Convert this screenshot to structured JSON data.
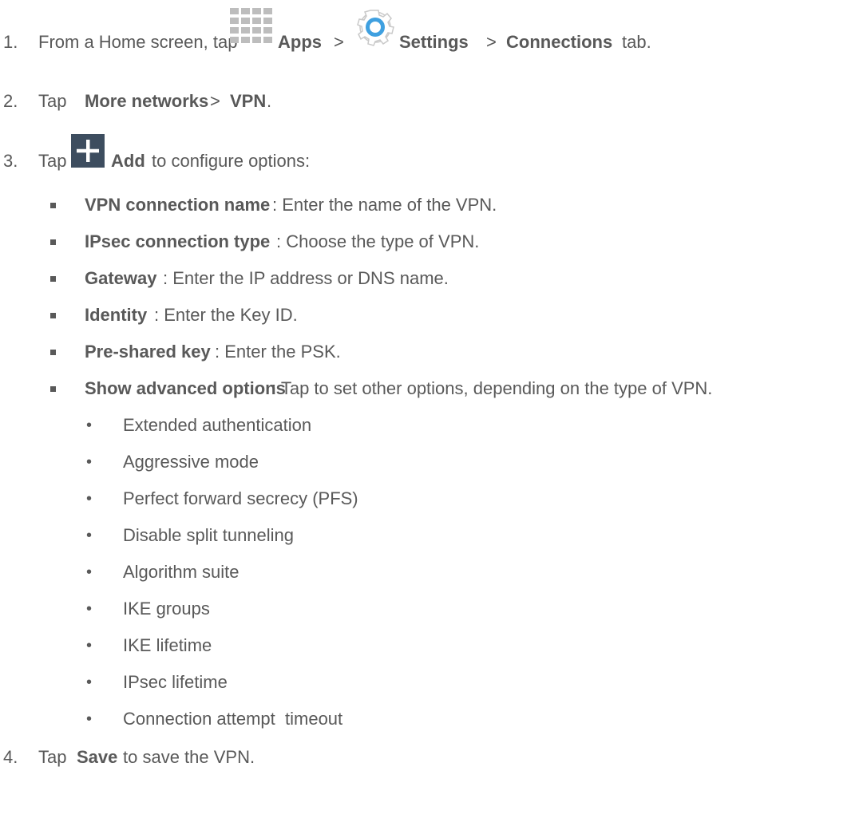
{
  "steps": [
    {
      "number": "1.",
      "parts": {
        "prefix": "From a Home screen, tap",
        "apps": "Apps",
        "sep1": ">",
        "settings": "Settings",
        "sep2": ">",
        "connections": "Connections",
        "suffix": "tab."
      }
    },
    {
      "number": "2.",
      "parts": {
        "prefix": "Tap",
        "more": "More networks",
        "sep": ">",
        "vpn": "VPN",
        "suffix": "."
      }
    },
    {
      "number": "3.",
      "parts": {
        "prefix": "Tap",
        "add": "Add",
        "suffix": "to configure options:"
      }
    },
    {
      "number": "4.",
      "parts": {
        "prefix": "Tap",
        "save": "Save",
        "suffix": "to save the VPN."
      }
    }
  ],
  "options": [
    {
      "term": "VPN connection name",
      "desc": ": Enter the name of the VPN."
    },
    {
      "term": "IPsec connection type",
      "desc": ": Choose the type of VPN."
    },
    {
      "term": "Gateway",
      "desc": ": Enter the IP address or DNS name."
    },
    {
      "term": "Identity",
      "desc": ": Enter the Key ID."
    },
    {
      "term": "Pre-shared key",
      "desc": ": Enter the PSK."
    },
    {
      "term": "Show advanced options",
      "desc": ": Tap to set other options, depending on the type of VPN."
    }
  ],
  "advanced": [
    "Extended authentication",
    "Aggressive mode",
    "Perfect forward secrecy (PFS)",
    "Disable split tunneling",
    "Algorithm suite",
    "IKE groups",
    "IKE lifetime",
    "IPsec lifetime",
    "Connection attempt  timeout"
  ],
  "bullets": {
    "square": "■",
    "dot": "•"
  },
  "icons": {
    "apps": "apps-grid-icon",
    "settings": "settings-gear-icon",
    "add": "add-plus-icon"
  },
  "colors": {
    "text": "#595959",
    "apps_icon": "#bdbdbd",
    "settings_icon": "#3fa0e0",
    "add_icon_bg": "#3d4d5f"
  }
}
